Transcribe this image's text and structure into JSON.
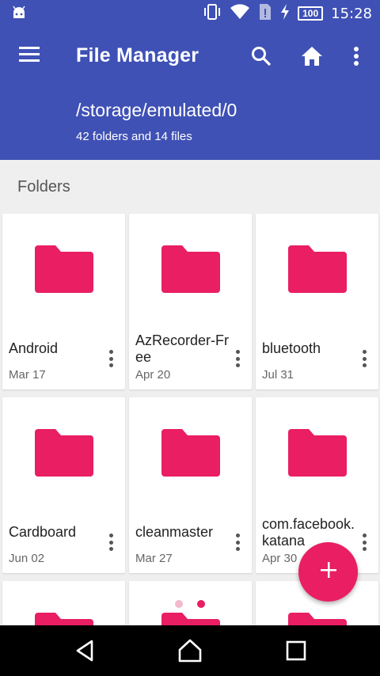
{
  "status_bar": {
    "time": "15:28",
    "battery_level": "100",
    "icons": [
      "android-icon",
      "vibrate-icon",
      "wifi-icon",
      "sim-alert-icon",
      "charging-icon",
      "battery-icon"
    ]
  },
  "app_bar": {
    "title": "File Manager",
    "path": "/storage/emulated/0",
    "summary": "42 folders and 14 files",
    "actions": [
      "menu-icon",
      "search-icon",
      "home-icon",
      "more-vert-icon"
    ]
  },
  "section_label": "Folders",
  "folders": [
    {
      "name": "Android",
      "date": "Mar 17"
    },
    {
      "name": "AzRecorder-Free",
      "date": "Apr 20"
    },
    {
      "name": "bluetooth",
      "date": "Jul 31"
    },
    {
      "name": "Cardboard",
      "date": "Jun 02"
    },
    {
      "name": "cleanmaster",
      "date": "Mar 27"
    },
    {
      "name": "com.facebook.katana",
      "date": "Apr 30"
    }
  ],
  "fab_label": "+",
  "colors": {
    "primary": "#3f51b5",
    "accent": "#e91e63",
    "folder": "#e91e63"
  }
}
